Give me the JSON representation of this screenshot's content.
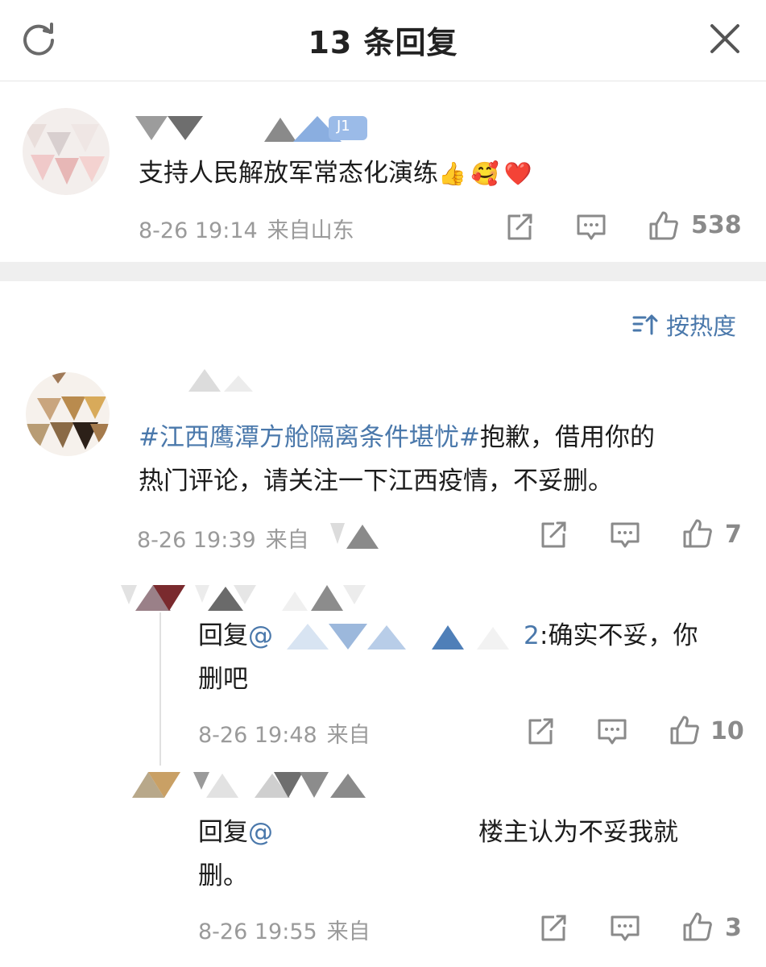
{
  "header": {
    "title": "13 条回复",
    "refresh_icon": "refresh-icon",
    "close_icon": "close-icon"
  },
  "main_comment": {
    "text": "支持人民解放军常态化演练",
    "emojis": [
      "👍",
      "🥰",
      "❤️"
    ],
    "time": "8-26 19:14",
    "location": "来自山东",
    "likes": "538",
    "name_suffix": "J1"
  },
  "sort": {
    "label": "按热度",
    "icon": "sort-icon"
  },
  "replies": [
    {
      "hashtag": "#江西鹰潭方舱隔离条件堪忧#",
      "text_line1": "抱歉，借用你的",
      "text_line2": "热门评论，请关注一下江西疫情，不妥删。",
      "time": "8-26 19:39",
      "location": "来自",
      "likes": "7"
    },
    {
      "prefix": "回复",
      "mention": "@",
      "mention_tail": "2",
      "text_line1": ":确实不妥，你",
      "text_line2": "删吧",
      "time": "8-26 19:48",
      "location": "来自",
      "likes": "10"
    },
    {
      "prefix": "回复",
      "mention": "@",
      "text_line1": "楼主认为不妥我就",
      "text_line2": "删。",
      "time": "8-26 19:55",
      "location": "来自",
      "likes": "3"
    }
  ],
  "colors": {
    "accent": "#4a78ab",
    "meta_gray": "#9a9a9a",
    "band": "#efefef"
  }
}
